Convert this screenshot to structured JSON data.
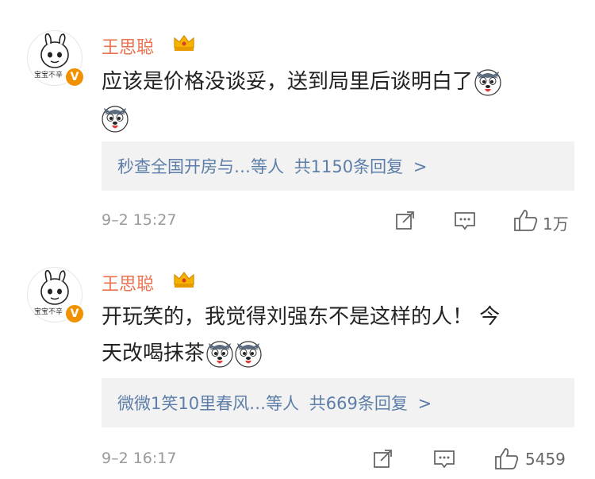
{
  "comments": [
    {
      "username": "王思聪",
      "avatar_caption": "宝宝不辛",
      "text": "应该是价格没谈妥，送到局里后谈明白了",
      "reply": {
        "users": "秒查全国开房与…等人",
        "count": "共1150条回复",
        "arrow": ">"
      },
      "time": "9–2 15:27",
      "likes": "1万"
    },
    {
      "username": "王思聪",
      "avatar_caption": "宝宝不辛",
      "text_line1": "开玩笑的，我觉得刘强东不是这样的人！ 今",
      "text_line2": "天改喝抹茶",
      "reply": {
        "users": "微微1笑10里春风…等人",
        "count": "共669条回复",
        "arrow": ">"
      },
      "time": "9–2 16:17",
      "likes": "5459"
    }
  ],
  "icons": {
    "share": "share-icon",
    "comment": "comment-icon",
    "like": "thumbs-up-icon",
    "crown": "crown-icon",
    "verified": "verified-badge-icon",
    "emoji": "husky-emoji-icon"
  },
  "colors": {
    "username": "#eb7350",
    "reply_link": "#5c7ea8",
    "reply_bg": "#f2f2f2",
    "verified_badge": "#f29100"
  }
}
